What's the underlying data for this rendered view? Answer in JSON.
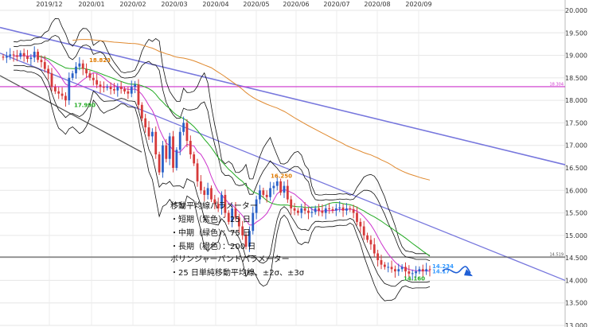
{
  "chart_data": {
    "type": "candlestick",
    "x_ticks": [
      "2019/12",
      "2020/01",
      "2020/02",
      "2020/03",
      "2020/04",
      "2020/05",
      "2020/06",
      "2020/07",
      "2020/08",
      "2020/09"
    ],
    "y_ticks": [
      "20.000",
      "19.500",
      "19.000",
      "18.500",
      "18.000",
      "17.500",
      "17.000",
      "16.500",
      "16.000",
      "15.500",
      "15.000",
      "14.500",
      "14.000",
      "13.500",
      "13.000"
    ],
    "ylim": [
      13.0,
      20.0
    ],
    "grid": true,
    "closes": [
      18.95,
      18.98,
      19.02,
      19.0,
      18.97,
      19.05,
      18.98,
      18.92,
      18.95,
      19.08,
      18.9,
      18.85,
      18.7,
      18.6,
      18.3,
      18.2,
      18.15,
      18.1,
      18.0,
      18.5,
      18.6,
      18.75,
      18.82,
      18.7,
      18.6,
      18.5,
      18.45,
      18.35,
      18.3,
      18.28,
      18.3,
      18.25,
      18.22,
      18.3,
      18.25,
      18.2,
      18.15,
      18.3,
      18.35,
      17.9,
      17.6,
      17.4,
      17.2,
      17.3,
      16.8,
      16.4,
      17.0,
      16.7,
      17.2,
      16.5,
      16.9,
      17.3,
      17.5,
      17.1,
      16.8,
      16.6,
      16.2,
      16.0,
      15.9,
      16.05,
      15.8,
      15.7,
      15.6,
      15.9,
      15.5,
      15.3,
      15.6,
      15.4,
      15.2,
      15.0,
      14.75,
      15.1,
      15.5,
      15.8,
      16.0,
      15.9,
      15.85,
      16.05,
      16.1,
      16.2,
      15.95,
      16.1,
      15.8,
      15.6,
      15.55,
      15.5,
      15.6,
      15.55,
      15.5,
      15.52,
      15.6,
      15.55,
      15.5,
      15.6,
      15.58,
      15.55,
      15.6,
      15.62,
      15.55,
      15.6,
      15.58,
      15.5,
      15.3,
      15.2,
      15.0,
      14.9,
      14.8,
      14.6,
      14.45,
      14.35,
      14.3,
      14.3,
      14.25,
      14.2,
      14.25,
      14.3,
      14.2,
      14.15,
      14.16,
      14.2,
      14.25,
      14.2,
      14.25,
      14.23
    ],
    "horizontal_lines": [
      {
        "value": 18.304,
        "label": "18.304",
        "color": "#cc33cc"
      },
      {
        "value": 14.519,
        "label": "14.519",
        "color": "#555555"
      }
    ],
    "price_labels": [
      {
        "text": "18.823",
        "color": "#e07b00"
      },
      {
        "text": "17.990",
        "color": "#22aa22"
      },
      {
        "text": "16.250",
        "color": "#e07b00"
      },
      {
        "text": "14.160",
        "color": "#22aa22"
      },
      {
        "text": "14.234",
        "color": "#3399ff"
      },
      {
        "text": "14.17",
        "color": "#3399ff"
      }
    ],
    "moving_averages": [
      {
        "period": 25,
        "color": "#cc33cc"
      },
      {
        "period": 75,
        "color": "#22aa22"
      },
      {
        "period": 200,
        "color": "#e08a30"
      }
    ],
    "bollinger": {
      "period": 25,
      "sigmas": [
        2,
        3
      ],
      "color": "#111111"
    },
    "annotation_lines": [
      "移動平均線パラメーター",
      "・短期（紫色）：25 日",
      "・中期（緑色）：75 日",
      "・長期（橙色）：200 日",
      "ボリンジャーバンドパラメーター",
      "・25 日単純移動平均線、±2σ、±3σ"
    ],
    "colors": {
      "up": "#2a62c8",
      "down": "#d63a3a",
      "trendline": "#7777dd",
      "trendline_dark": "#555555",
      "forecast": "#1f5fd6"
    }
  }
}
